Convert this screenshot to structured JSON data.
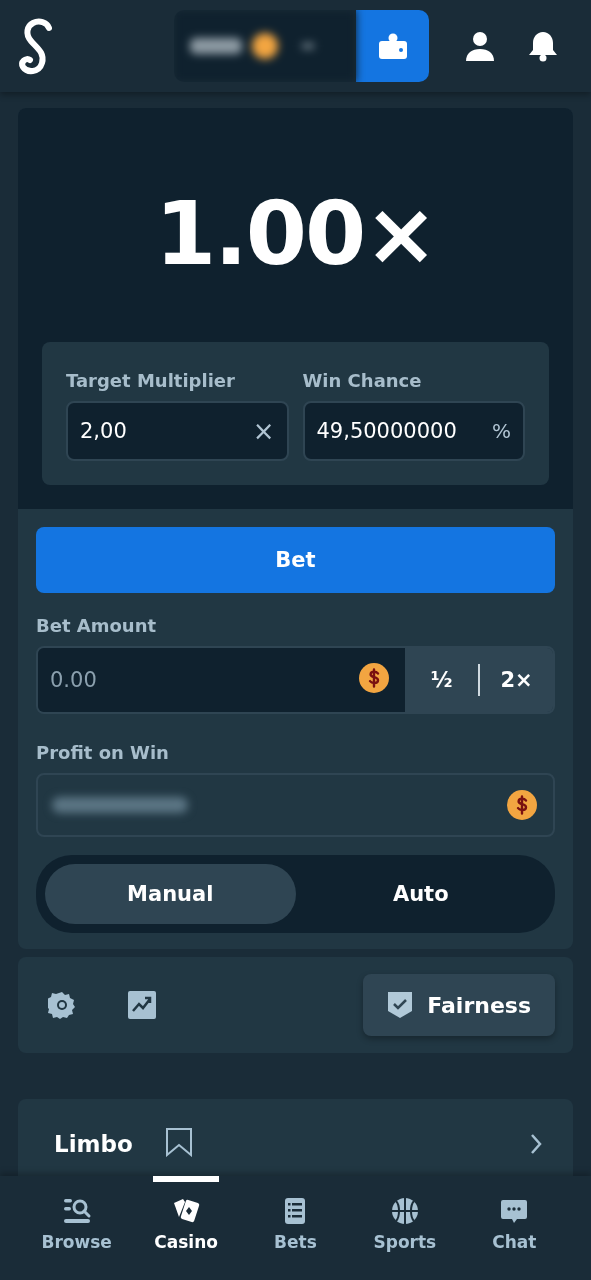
{
  "multiplier": "1.00×",
  "target": {
    "label": "Target Multiplier",
    "value": "2,00",
    "suffix": "×"
  },
  "chance": {
    "label": "Win Chance",
    "value": "49,50000000",
    "suffix": "%"
  },
  "bet_button": "Bet",
  "bet_amount": {
    "label": "Bet Amount",
    "placeholder": "0.00",
    "half": "½",
    "double": "2×"
  },
  "profit": {
    "label": "Profit on Win"
  },
  "modes": [
    {
      "label": "Manual",
      "selected": true
    },
    {
      "label": "Auto",
      "selected": false
    }
  ],
  "fairness": "Fairness",
  "game": {
    "title": "Limbo"
  },
  "nav": [
    {
      "label": "Browse",
      "kind": "browse",
      "selected": false
    },
    {
      "label": "Casino",
      "kind": "casino",
      "selected": true
    },
    {
      "label": "Bets",
      "kind": "bets",
      "selected": false
    },
    {
      "label": "Sports",
      "kind": "sports",
      "selected": false
    },
    {
      "label": "Chat",
      "kind": "chat",
      "selected": false
    }
  ]
}
